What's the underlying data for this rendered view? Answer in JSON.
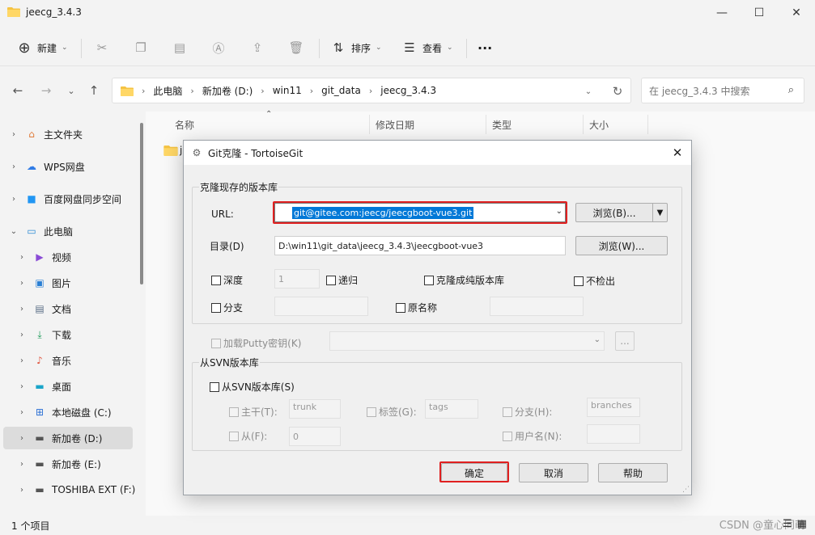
{
  "window": {
    "title": "jeecg_3.4.3"
  },
  "toolbar": {
    "new_label": "新建",
    "sort_label": "排序",
    "view_label": "查看",
    "more_label": "···"
  },
  "address": {
    "segments": [
      "此电脑",
      "新加卷 (D:)",
      "win11",
      "git_data",
      "jeecg_3.4.3"
    ],
    "search_placeholder": "在 jeecg_3.4.3 中搜索"
  },
  "sidebar": {
    "items": [
      {
        "label": "主文件夹"
      },
      {
        "label": "WPS网盘"
      },
      {
        "label": "百度网盘同步空间"
      },
      {
        "label": "此电脑"
      },
      {
        "label": "视频"
      },
      {
        "label": "图片"
      },
      {
        "label": "文档"
      },
      {
        "label": "下载"
      },
      {
        "label": "音乐"
      },
      {
        "label": "桌面"
      },
      {
        "label": "本地磁盘 (C:)"
      },
      {
        "label": "新加卷 (D:)"
      },
      {
        "label": "新加卷 (E:)"
      },
      {
        "label": "TOSHIBA EXT (F:)"
      }
    ]
  },
  "columns": {
    "name": "名称",
    "modified": "修改日期",
    "type": "类型",
    "size": "大小"
  },
  "file_row_fragment": "j",
  "status": {
    "count": "1 个项目",
    "watermark": "CSDN @童心同萌"
  },
  "dialog": {
    "title": "Git克隆 - TortoiseGit",
    "group_clone": "克隆现存的版本库",
    "url_label": "URL:",
    "url_value": "git@gitee.com:jeecg/jeecgboot-vue3.git",
    "browse_b": "浏览(B)...",
    "dir_label": "目录(D)",
    "dir_value": "D:\\win11\\git_data\\jeecg_3.4.3\\jeecgboot-vue3",
    "browse_w": "浏览(W)...",
    "depth_label": "深度",
    "depth_value": "1",
    "recursive_label": "递归",
    "bare_label": "克隆成纯版本库",
    "no_checkout_label": "不检出",
    "branch_label": "分支",
    "origin_label": "原名称",
    "putty_label": "加载Putty密钥(K)",
    "putty_btn": "...",
    "group_svn": "从SVN版本库",
    "from_svn_label": "从SVN版本库(S)",
    "trunk_label": "主干(T):",
    "trunk_value": "trunk",
    "tags_label": "标签(G):",
    "tags_value": "tags",
    "branches_label": "分支(H):",
    "branches_value": "branches",
    "from_label": "从(F):",
    "from_value": "0",
    "username_label": "用户名(N):",
    "ok": "确定",
    "cancel": "取消",
    "help": "帮助"
  },
  "colors": {
    "selection": "#0078d7",
    "highlight_box": "#e02020"
  }
}
